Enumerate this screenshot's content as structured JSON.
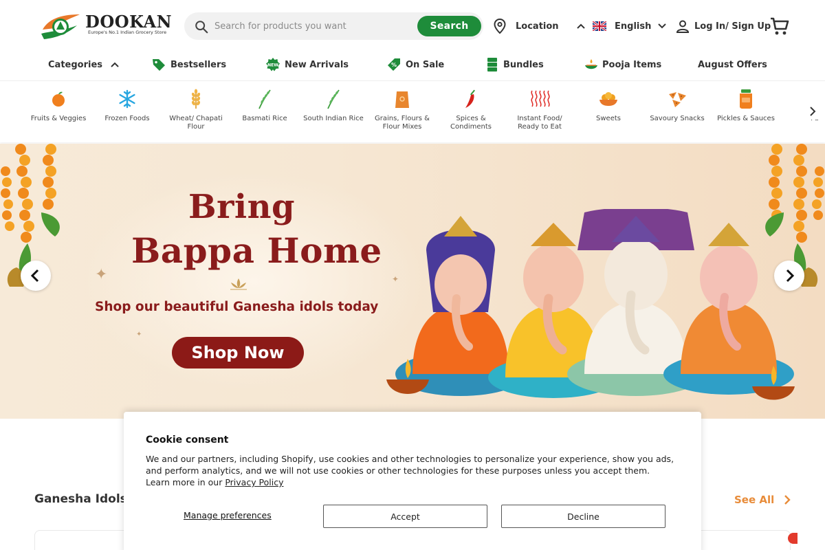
{
  "brand": {
    "name": "DOOKAN",
    "tagline": "Europe's No.1 Indian Grocery Store",
    "colors": {
      "green": "#1e8c3a",
      "maroon": "#8a1c1c",
      "orange": "#e88c3a"
    }
  },
  "header": {
    "search": {
      "placeholder": "Search for products you want",
      "button": "Search"
    },
    "location": {
      "label": "Location",
      "icon": "location-pin-icon"
    },
    "language": {
      "label": "English",
      "icon": "uk-flag-icon"
    },
    "login": {
      "label": "Log In/ Sign Up",
      "icon": "user-icon"
    },
    "cart_icon": "cart-icon"
  },
  "nav": {
    "categories": "Categories",
    "bestsellers": "Bestsellers",
    "new_arrivals": "New Arrivals",
    "on_sale": "On Sale",
    "bundles": "Bundles",
    "pooja_items": "Pooja Items",
    "august_offers": "August Offers"
  },
  "categories": [
    {
      "label": "Fruits & Veggies",
      "icon": "orange-fruit-icon"
    },
    {
      "label": "Frozen Foods",
      "icon": "snowflake-icon"
    },
    {
      "label": "Wheat/ Chapati Flour",
      "icon": "wheat-icon"
    },
    {
      "label": "Basmati Rice",
      "icon": "rice-stalk-icon"
    },
    {
      "label": "South Indian Rice",
      "icon": "rice-stalk-icon"
    },
    {
      "label": "Grains, Flours & Flour Mixes",
      "icon": "flour-sack-icon"
    },
    {
      "label": "Spices & Condiments",
      "icon": "chili-icon"
    },
    {
      "label": "Instant Food/ Ready to Eat",
      "icon": "steam-icon"
    },
    {
      "label": "Sweets",
      "icon": "sweets-bowl-icon"
    },
    {
      "label": "Savoury Snacks",
      "icon": "snacks-icon"
    },
    {
      "label": "Pickles & Sauces",
      "icon": "pickle-jar-icon"
    },
    {
      "label": "Pa",
      "icon": "truncated-icon"
    }
  ],
  "banner": {
    "title_line1": "Bring",
    "title_line2": "Bappa Home",
    "subtitle": "Shop our beautiful Ganesha idols today",
    "cta": "Shop Now"
  },
  "section": {
    "title": "Ganesha Idols",
    "see_all": "See All"
  },
  "cookie": {
    "title": "Cookie consent",
    "text": "We and our partners, including Shopify, use cookies and other technologies to personalize your experience, show you ads, and perform analytics, and we will not use cookies or other technologies for these purposes unless you accept them. Learn more in our",
    "link": "Privacy Policy",
    "manage": "Manage preferences",
    "accept": "Accept",
    "decline": "Decline"
  }
}
